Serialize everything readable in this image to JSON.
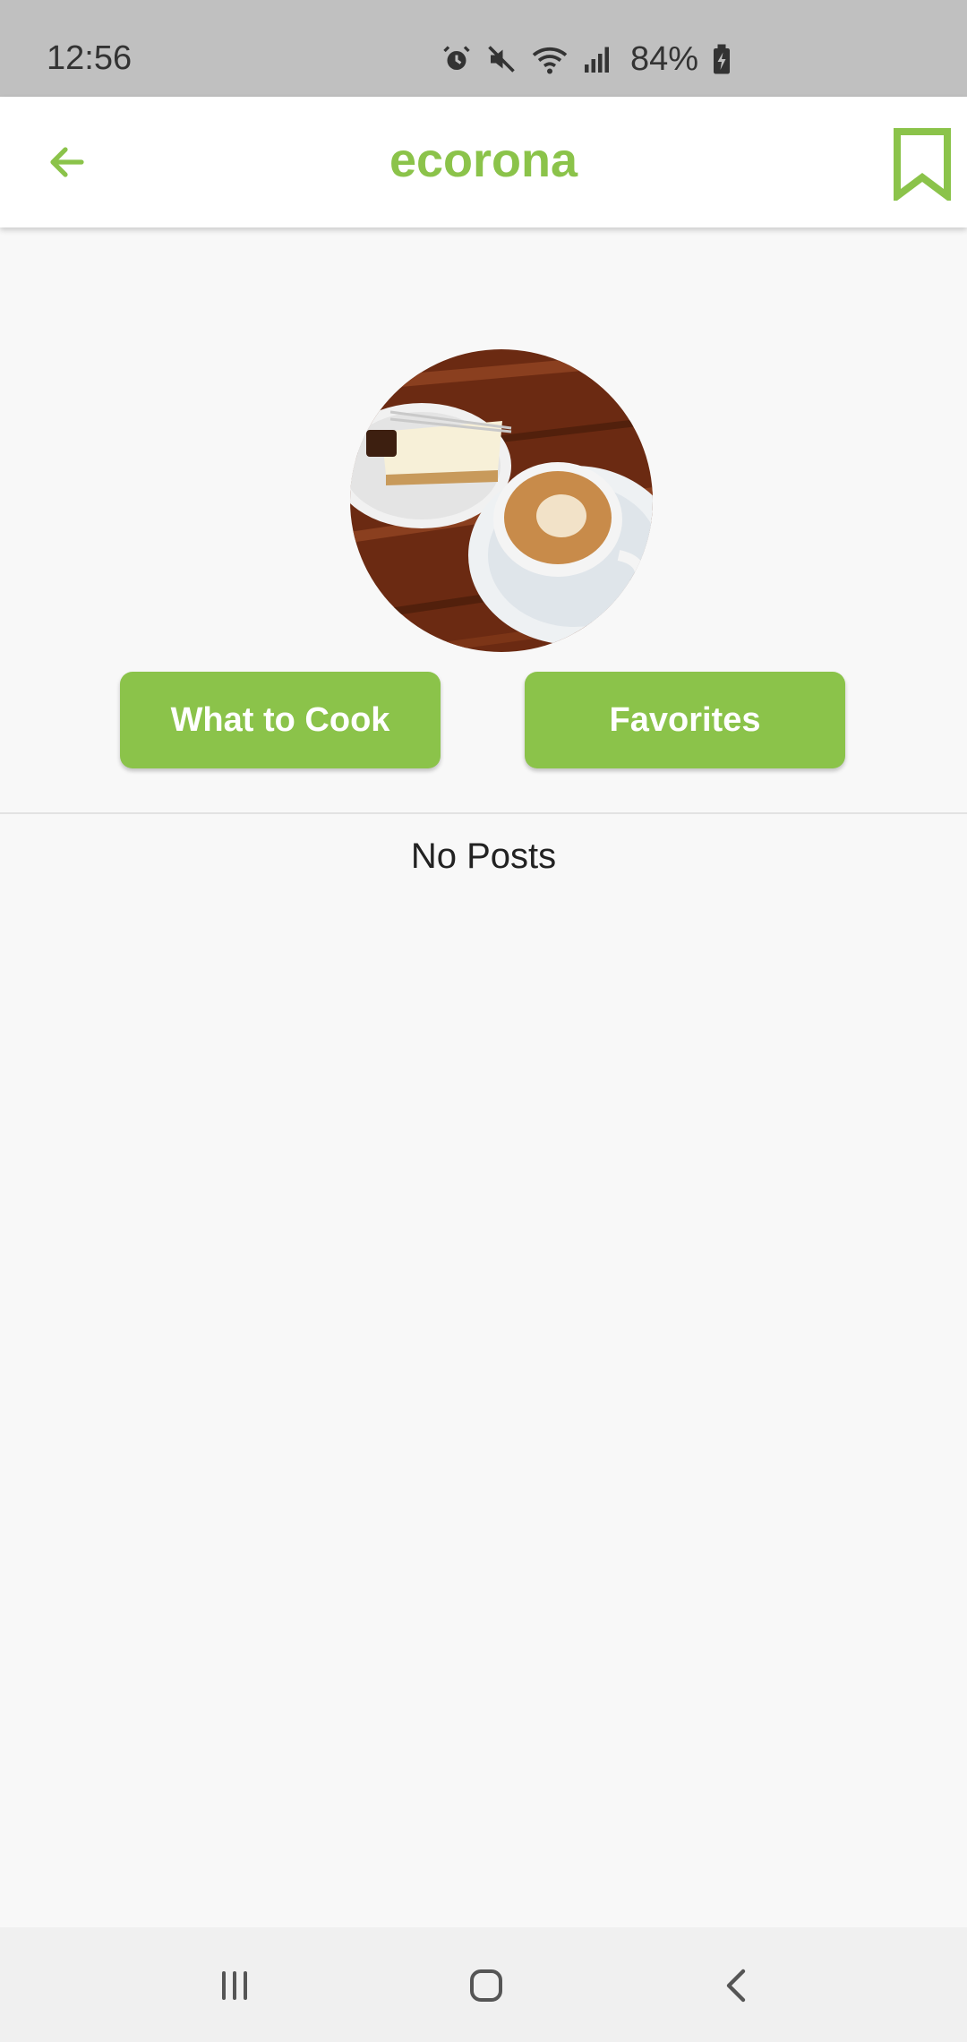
{
  "status_bar": {
    "time": "12:56",
    "battery": "84%",
    "icons": [
      "alarm-icon",
      "mute-icon",
      "wifi-icon",
      "signal-icon",
      "battery-charging-icon"
    ]
  },
  "app_bar": {
    "title": "ecorona",
    "back_icon": "arrow-left-icon",
    "bookmark_icon": "bookmark-icon"
  },
  "profile": {
    "avatar_alt": "Cheesecake and cappuccino"
  },
  "actions": {
    "what_to_cook_label": "What to Cook",
    "favorites_label": "Favorites"
  },
  "posts": {
    "empty_message": "No Posts"
  },
  "nav_bar": {
    "icons": [
      "recents-icon",
      "home-icon",
      "back-icon"
    ]
  },
  "colors": {
    "accent": "#8bc34a",
    "status_bar": "#c0c0c0",
    "background": "#f8f8f8"
  }
}
